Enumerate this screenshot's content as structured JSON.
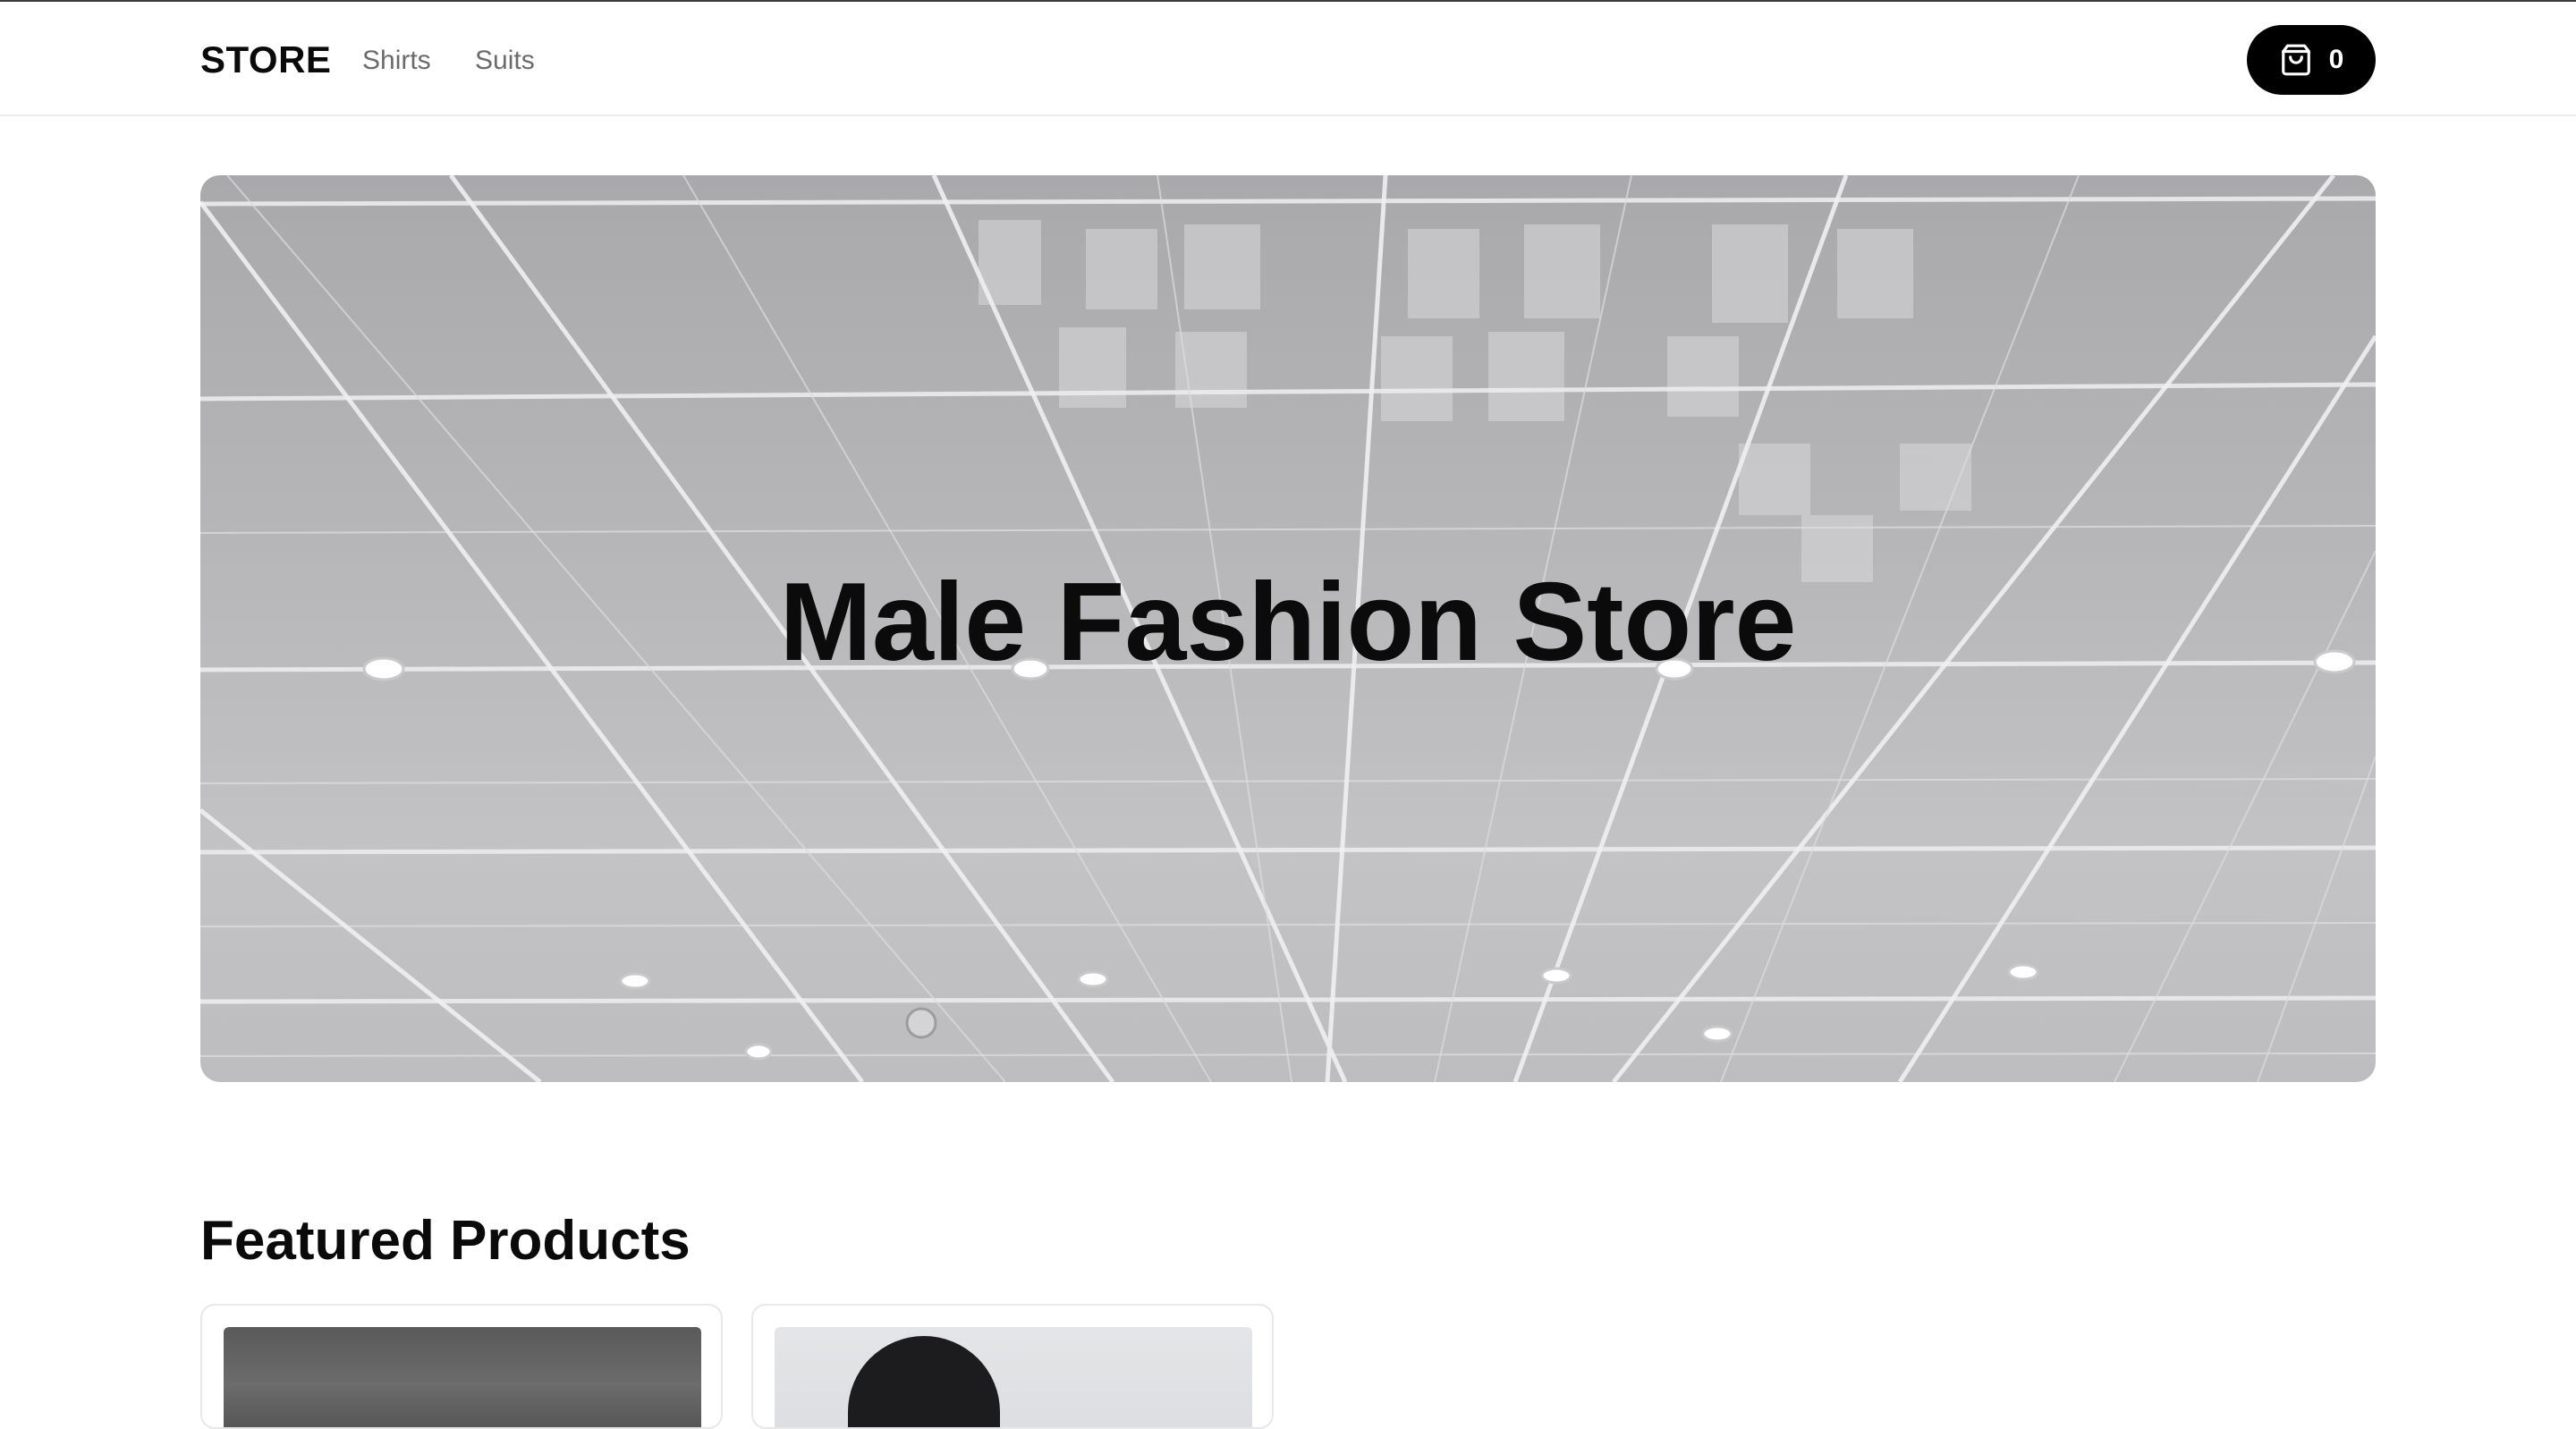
{
  "header": {
    "brand": "STORE",
    "nav": [
      {
        "label": "Shirts"
      },
      {
        "label": "Suits"
      }
    ],
    "cart": {
      "icon": "shopping-bag-icon",
      "count": "0"
    }
  },
  "hero": {
    "title": "Male Fashion Store",
    "image": "mirrored-ceiling-panels"
  },
  "featured": {
    "title": "Featured Products",
    "products": [
      {
        "image": "dark-textured-product-photo"
      },
      {
        "image": "man-portrait-product-photo"
      }
    ]
  },
  "colors": {
    "accent": "#000000",
    "text": "#0a0a0a",
    "muted": "#6b6b6b",
    "border": "#e8e8e8"
  }
}
